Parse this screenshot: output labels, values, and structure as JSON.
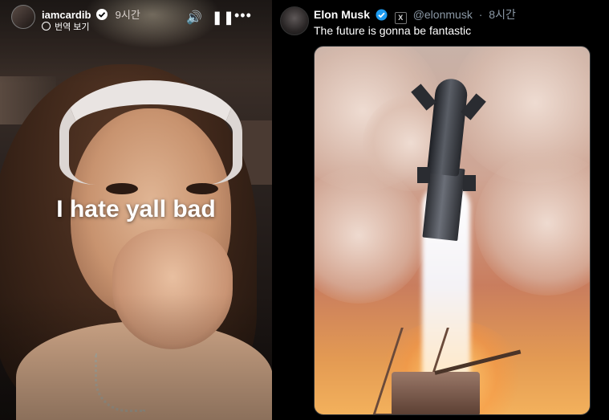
{
  "story": {
    "username": "iamcardib",
    "time": "9시간",
    "translate_label": "번역 보기",
    "caption": "I hate yall bad",
    "volume_icon": "speaker-icon",
    "pause_icon": "pause-icon",
    "more_icon": "more-icon"
  },
  "tweet": {
    "name": "Elon Musk",
    "handle": "@elonmusk",
    "time": "8시간",
    "text": "The future is gonna be fantastic",
    "verified_color": "#1d9bf0",
    "media_alt_icon": "rocket-launch-image"
  }
}
